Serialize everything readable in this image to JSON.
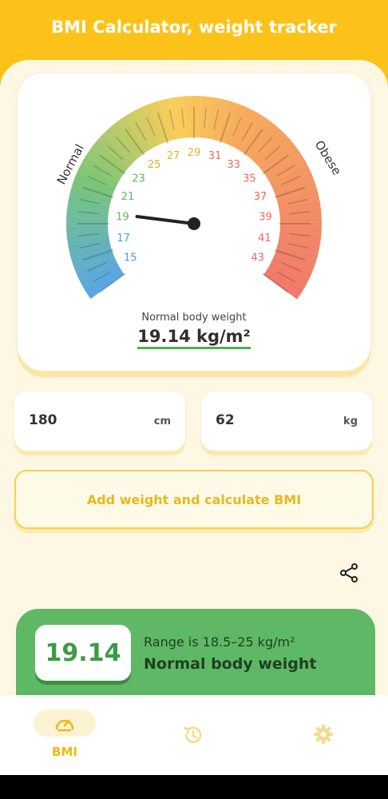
{
  "header": {
    "title": "BMI Calculator, weight tracker"
  },
  "gauge": {
    "label_left": "Normal",
    "label_right": "Obese",
    "ticks": [
      "15",
      "17",
      "19",
      "21",
      "23",
      "25",
      "27",
      "29",
      "31",
      "33",
      "35",
      "37",
      "39",
      "41",
      "43"
    ],
    "needle_value": 19.14,
    "status_small": "Normal body weight",
    "bmi_display": "19.14 kg/m²"
  },
  "inputs": {
    "height": {
      "value": "180",
      "unit": "cm"
    },
    "weight": {
      "value": "62",
      "unit": "kg"
    }
  },
  "actions": {
    "add_label": "Add weight and calculate BMI"
  },
  "result": {
    "value": "19.14",
    "range": "Range is 18.5–25 kg/m²",
    "status": "Normal body weight"
  },
  "nav": {
    "items": [
      {
        "label": "BMI",
        "icon": "gauge-icon"
      },
      {
        "label": "",
        "icon": "history-icon"
      },
      {
        "label": "",
        "icon": "gear-icon"
      }
    ]
  },
  "colors": {
    "accent": "#fdc21a",
    "normal": "#5fb865",
    "underweight": "#4a9de0",
    "obese": "#ee6a5d"
  }
}
